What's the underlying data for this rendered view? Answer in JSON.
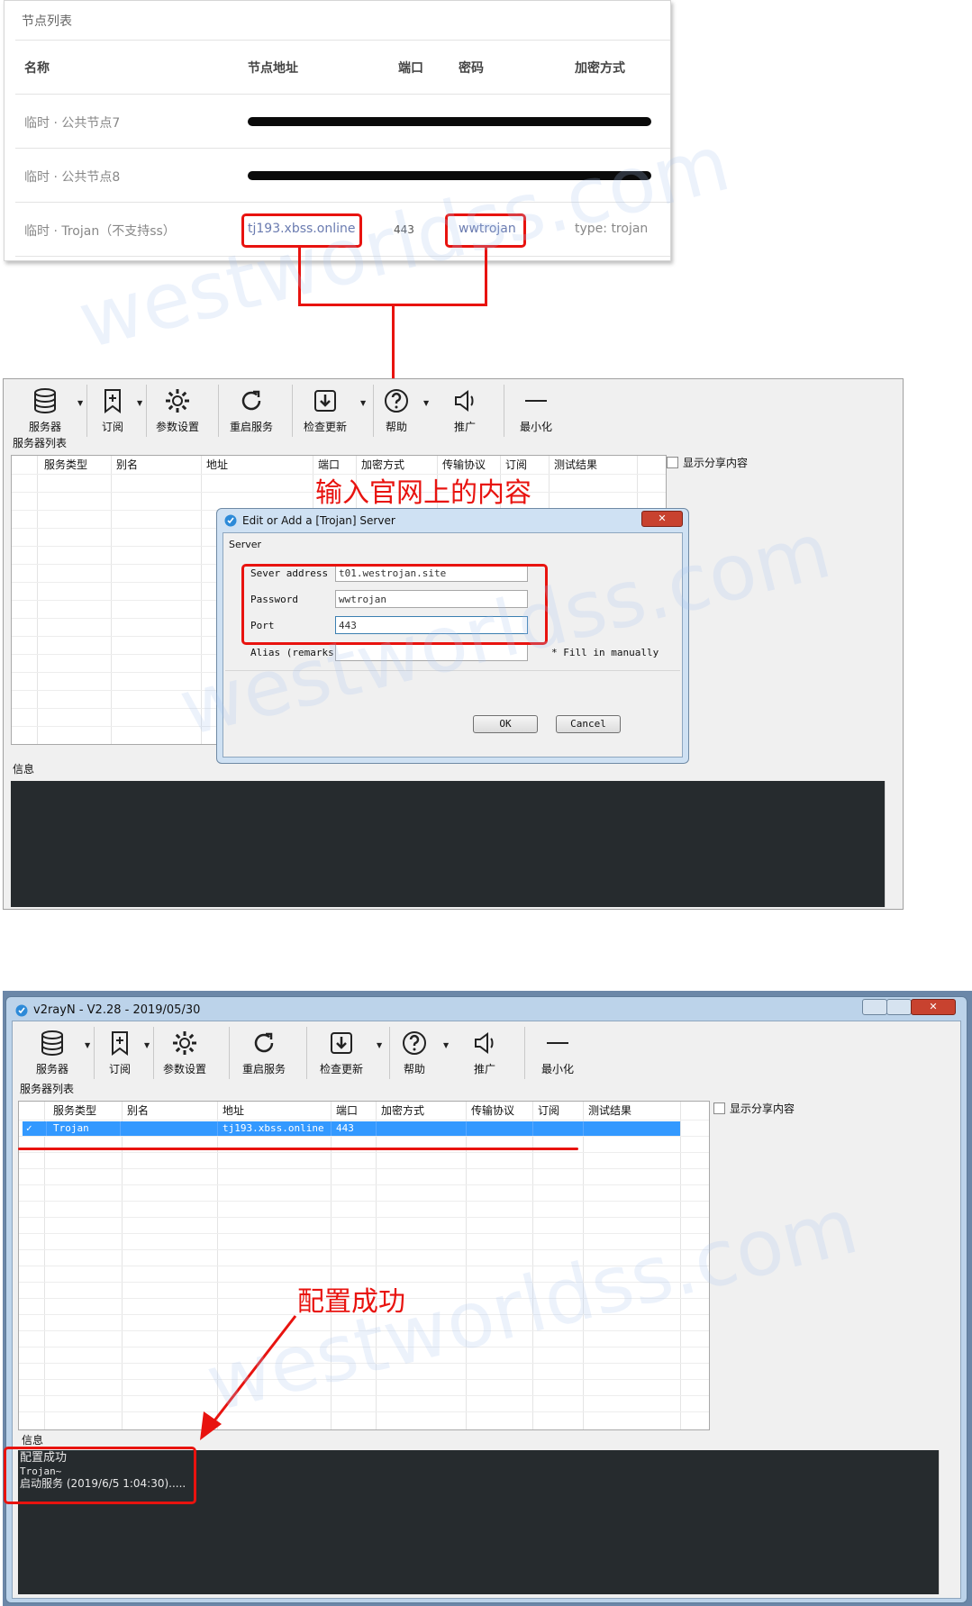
{
  "node_list": {
    "title": "节点列表",
    "columns": [
      "名称",
      "节点地址",
      "端口",
      "密码",
      "加密方式"
    ],
    "rows": [
      {
        "name": "临时 · 公共节点7",
        "address": "",
        "port": "",
        "password": "",
        "method": ""
      },
      {
        "name": "临时 · 公共节点8",
        "address": "",
        "port": "",
        "password": "",
        "method": ""
      },
      {
        "name": "临时 · Trojan（不支持ss）",
        "address": "tj193.xbss.online",
        "port": "443",
        "password": "wwtrojan",
        "method": "type: trojan"
      }
    ]
  },
  "toolbar": {
    "servers": "服务器",
    "subscribe": "订阅",
    "settings": "参数设置",
    "restart": "重启服务",
    "update": "检查更新",
    "help": "帮助",
    "promote": "推广",
    "minimize": "最小化"
  },
  "server_list": {
    "label": "服务器列表",
    "columns": [
      "服务类型",
      "别名",
      "地址",
      "端口",
      "加密方式",
      "传输协议",
      "订阅",
      "测试结果"
    ],
    "share_checkbox": "显示分享内容"
  },
  "info_label": "信息",
  "dialog": {
    "title": "Edit or Add a [Trojan] Server",
    "group": "Server",
    "address_label": "Sever address",
    "address_value": "t01.westrojan.site",
    "password_label": "Password",
    "password_value": "wwtrojan",
    "port_label": "Port",
    "port_value": "443",
    "alias_label": "Alias (remarks)",
    "alias_value": "",
    "hint": "* Fill in manually",
    "ok": "OK",
    "cancel": "Cancel",
    "close": "✕"
  },
  "annotations": {
    "enter_site": "输入官网上的内容",
    "config_success": "配置成功"
  },
  "main_window": {
    "title": "v2rayN - V2.28 - 2019/05/30",
    "row": {
      "selected": "✓",
      "type": "Trojan",
      "alias": "",
      "address": "tj193.xbss.online",
      "port": "443",
      "method": "",
      "network": "",
      "subscription": "",
      "test": ""
    },
    "log": [
      "配置成功",
      "Trojan~",
      "启动服务 (2019/6/5 1:04:30)....."
    ]
  },
  "watermark": "westworldss.com",
  "colors": {
    "accent": "#e8130f",
    "selection": "#3399ff",
    "console": "#262b2e"
  }
}
